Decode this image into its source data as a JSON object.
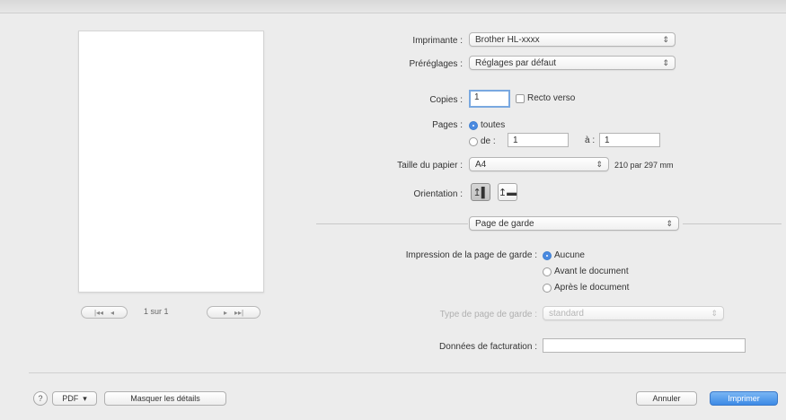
{
  "printer": {
    "label": "Imprimante :",
    "value": "Brother HL-xxxx"
  },
  "presets": {
    "label": "Préréglages :",
    "value": "Réglages par défaut"
  },
  "copies": {
    "label": "Copies :",
    "value": "1",
    "duplex_label": "Recto verso"
  },
  "pages": {
    "label": "Pages :",
    "all_label": "toutes",
    "from_label": "de :",
    "from_value": "1",
    "to_label": "à :",
    "to_value": "1"
  },
  "paper_size": {
    "label": "Taille du papier :",
    "value": "A4",
    "dimensions": "210 par 297 mm"
  },
  "orientation": {
    "label": "Orientation :",
    "portrait_icon": "portrait-orientation-icon",
    "landscape_icon": "landscape-orientation-icon"
  },
  "section": {
    "value": "Page de garde"
  },
  "cover_page": {
    "label": "Impression de la page de garde :",
    "options": [
      "Aucune",
      "Avant le document",
      "Après le document"
    ],
    "selected_index": 0
  },
  "cover_type": {
    "label": "Type de page de garde :",
    "value": "standard"
  },
  "billing": {
    "label": "Données de facturation :",
    "value": ""
  },
  "preview": {
    "page_text": "1 sur 1",
    "first": "|◂◂",
    "prev": "◂",
    "next": "▸",
    "last": "▸▸|"
  },
  "footer": {
    "help": "?",
    "pdf": "PDF",
    "pdf_arrow": "▾",
    "hide_details": "Masquer les détails",
    "cancel": "Annuler",
    "print": "Imprimer"
  },
  "colors": {
    "accent": "#4a8ae0",
    "background": "#ececec"
  }
}
